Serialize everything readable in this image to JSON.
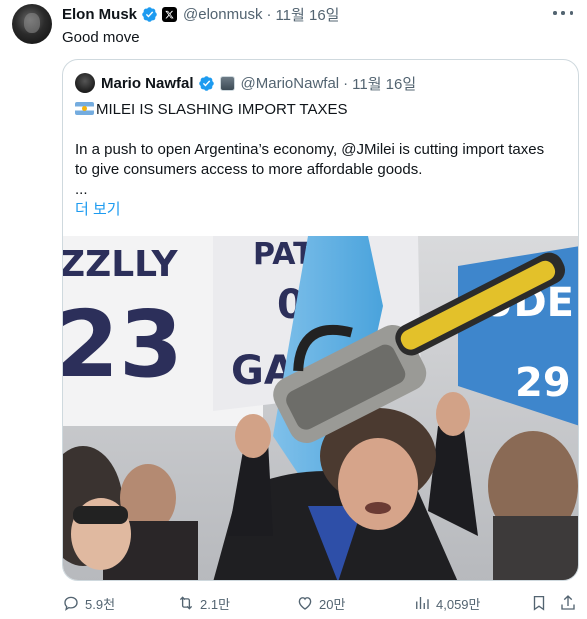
{
  "tweet": {
    "author_name": "Elon Musk",
    "handle": "@elonmusk",
    "separator": "·",
    "time": "11월 16일",
    "text": "Good move"
  },
  "quoted_tweet": {
    "author_name": "Mario Nawfal",
    "handle": "@MarioNawfal",
    "separator": "·",
    "time": "11월 16일",
    "headline": "MILEI IS SLASHING IMPORT TAXES",
    "body_line1": "In a push to open Argentina’s economy, @JMilei is cutting import taxes",
    "body_line2": "to give consumers access to more affordable goods.",
    "ellipsis": "...",
    "show_more": "더 보기",
    "photo_sign_left": [
      "ZZLLY",
      "23"
    ],
    "photo_sign_center": [
      "PAT",
      "09",
      "GAN"
    ],
    "photo_sign_right": [
      "UDE",
      "29"
    ]
  },
  "actions": {
    "replies": "5.9천",
    "reposts": "2.1만",
    "likes": "20만",
    "views": "4,059만"
  },
  "colors": {
    "verified_blue": "#1d9bf0",
    "text_primary": "#0f1419",
    "text_secondary": "#536471",
    "border": "#cfd9de",
    "link": "#1d9bf0"
  },
  "icons": {
    "more": "more-dots-icon",
    "verified": "verified-badge-icon",
    "affiliate": "x-affiliate-icon",
    "reply": "reply-icon",
    "repost": "repost-icon",
    "like": "heart-icon",
    "views": "bar-chart-icon",
    "bookmark": "bookmark-icon",
    "share": "share-icon"
  }
}
